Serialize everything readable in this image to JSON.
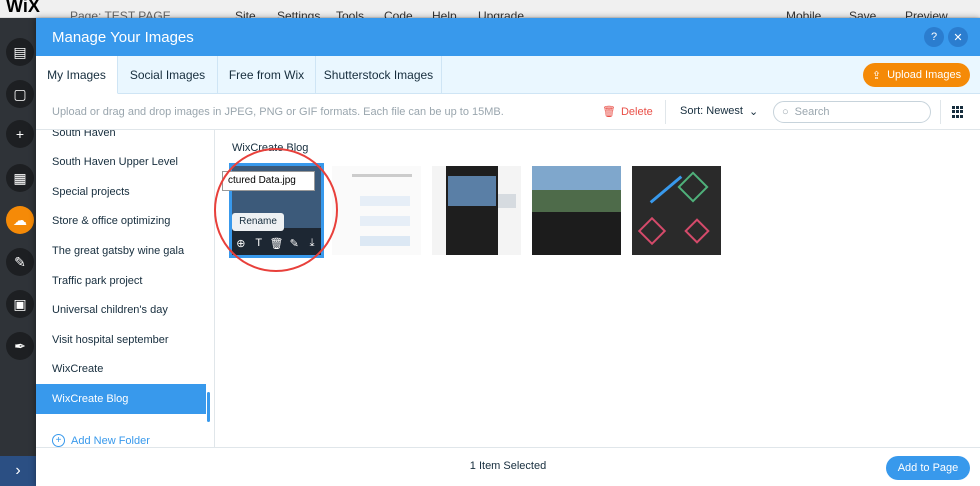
{
  "editor": {
    "logo": "WiX",
    "page_label": "Page: TEST PAGE",
    "menu": [
      "Site",
      "Settings",
      "Tools",
      "Code",
      "Help",
      "Upgrade"
    ],
    "mobile": "Mobile",
    "save": "Save",
    "preview": "Preview"
  },
  "modal": {
    "title": "Manage Your Images",
    "help": "?",
    "close": "✕"
  },
  "tabs": [
    "My Images",
    "Social Images",
    "Free from Wix",
    "Shutterstock Images"
  ],
  "upload_label": "Upload Images",
  "toolbar": {
    "hint": "Upload or drag and drop images in JPEG, PNG or GIF formats. Each file can be up to 15MB.",
    "delete": "Delete",
    "sort": "Sort: Newest",
    "search_placeholder": "Search"
  },
  "folders": [
    "South Haven",
    "South Haven Upper Level",
    "Special projects",
    "Store & office optimizing",
    "The great gatsby wine gala",
    "Traffic park project",
    "Universal children's day",
    "Visit hospital september",
    "WixCreate",
    "WixCreate Blog"
  ],
  "add_folder": "Add New Folder",
  "folder_title": "WixCreate Blog",
  "rename_value": "ctured Data.jpg",
  "rename_tooltip": "Rename",
  "footer": {
    "selected": "1 Item Selected",
    "add_to_page": "Add to Page"
  },
  "colors": {
    "accent": "#3899ec",
    "upload": "#f58a07",
    "delete": "#e94f47"
  }
}
